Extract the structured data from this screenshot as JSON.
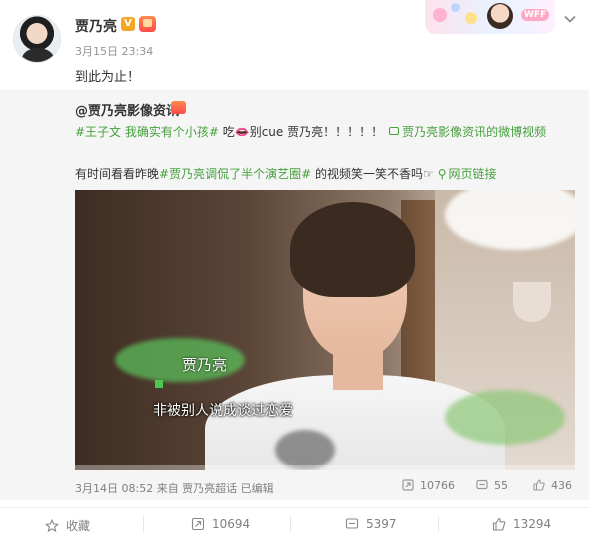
{
  "post": {
    "author": "贾乃亮",
    "time": "3月15日 23:34",
    "text": "到此为止！",
    "decor_tag": "WFF"
  },
  "repost": {
    "author": "@贾乃亮影像资讯",
    "topic1": "#王子文 我确实有个小孩#",
    "text1": " 吃👄别cue 贾乃亮！！！！！",
    "video_link": "贾乃亮影像资讯的微博视频",
    "text2_prefix": "有时间看看昨晚",
    "topic2": "#贾乃亮调侃了半个演艺圈#",
    "text2_suffix": " 的视频笑一笑不香吗☞",
    "web_link": "网页链接",
    "video": {
      "subtitle_name": "贾乃亮",
      "subtitle_text": "非被别人说成谈过恋爱",
      "progress": 0.0
    },
    "footer": "3月14日 08:52 来自 贾乃亮超话   已编辑",
    "reposts": "10766",
    "comments": "55",
    "likes": "436"
  },
  "actions": {
    "favorite": "收藏",
    "repost": "10694",
    "comment": "5397",
    "like": "13294"
  }
}
